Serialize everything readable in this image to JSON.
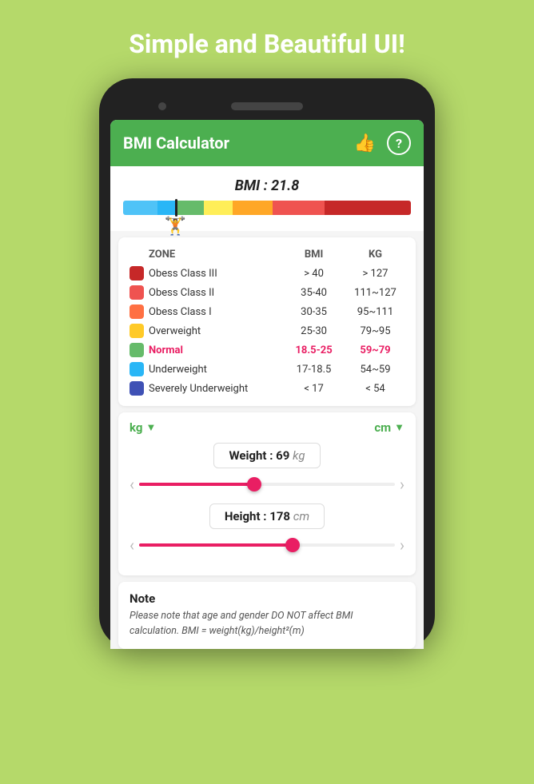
{
  "page": {
    "title": "Simple and Beautiful UI!",
    "bg_color": "#b5d96a"
  },
  "toolbar": {
    "title": "BMI Calculator",
    "like_icon": "👍",
    "help_icon": "?"
  },
  "bmi": {
    "label": "BMI : 21.8",
    "indicator_percent": 18,
    "pointer_symbol": "🏋"
  },
  "zones": {
    "headers": [
      "ZONE",
      "BMI",
      "KG"
    ],
    "rows": [
      {
        "color": "#c62828",
        "label": "Obess Class III",
        "bmi": "> 40",
        "kg": "> 127",
        "highlight": false
      },
      {
        "color": "#ef5350",
        "label": "Obess Class II",
        "bmi": "35-40",
        "kg": "111~127",
        "highlight": false
      },
      {
        "color": "#ff7043",
        "label": "Obess Class I",
        "bmi": "30-35",
        "kg": "95~111",
        "highlight": false
      },
      {
        "color": "#ffca28",
        "label": "Overweight",
        "bmi": "25-30",
        "kg": "79~95",
        "highlight": false
      },
      {
        "color": "#66bb6a",
        "label": "Normal",
        "bmi": "18.5-25",
        "kg": "59~79",
        "highlight": true
      },
      {
        "color": "#29b6f6",
        "label": "Underweight",
        "bmi": "17-18.5",
        "kg": "54~59",
        "highlight": false
      },
      {
        "color": "#3f51b5",
        "label": "Severely Underweight",
        "bmi": "< 17",
        "kg": "< 54",
        "highlight": false
      }
    ]
  },
  "weight": {
    "unit": "kg",
    "unit_chevron": "▼",
    "label": "Weight : 69",
    "unit_suffix": "kg",
    "slider_percent": 45
  },
  "height": {
    "unit": "cm",
    "unit_chevron": "▼",
    "label": "Height : 178",
    "unit_suffix": "cm",
    "slider_percent": 60
  },
  "note": {
    "title": "Note",
    "text": "Please note that age and gender DO NOT affect BMI calculation. BMI = weight(kg)/height²(m)"
  }
}
